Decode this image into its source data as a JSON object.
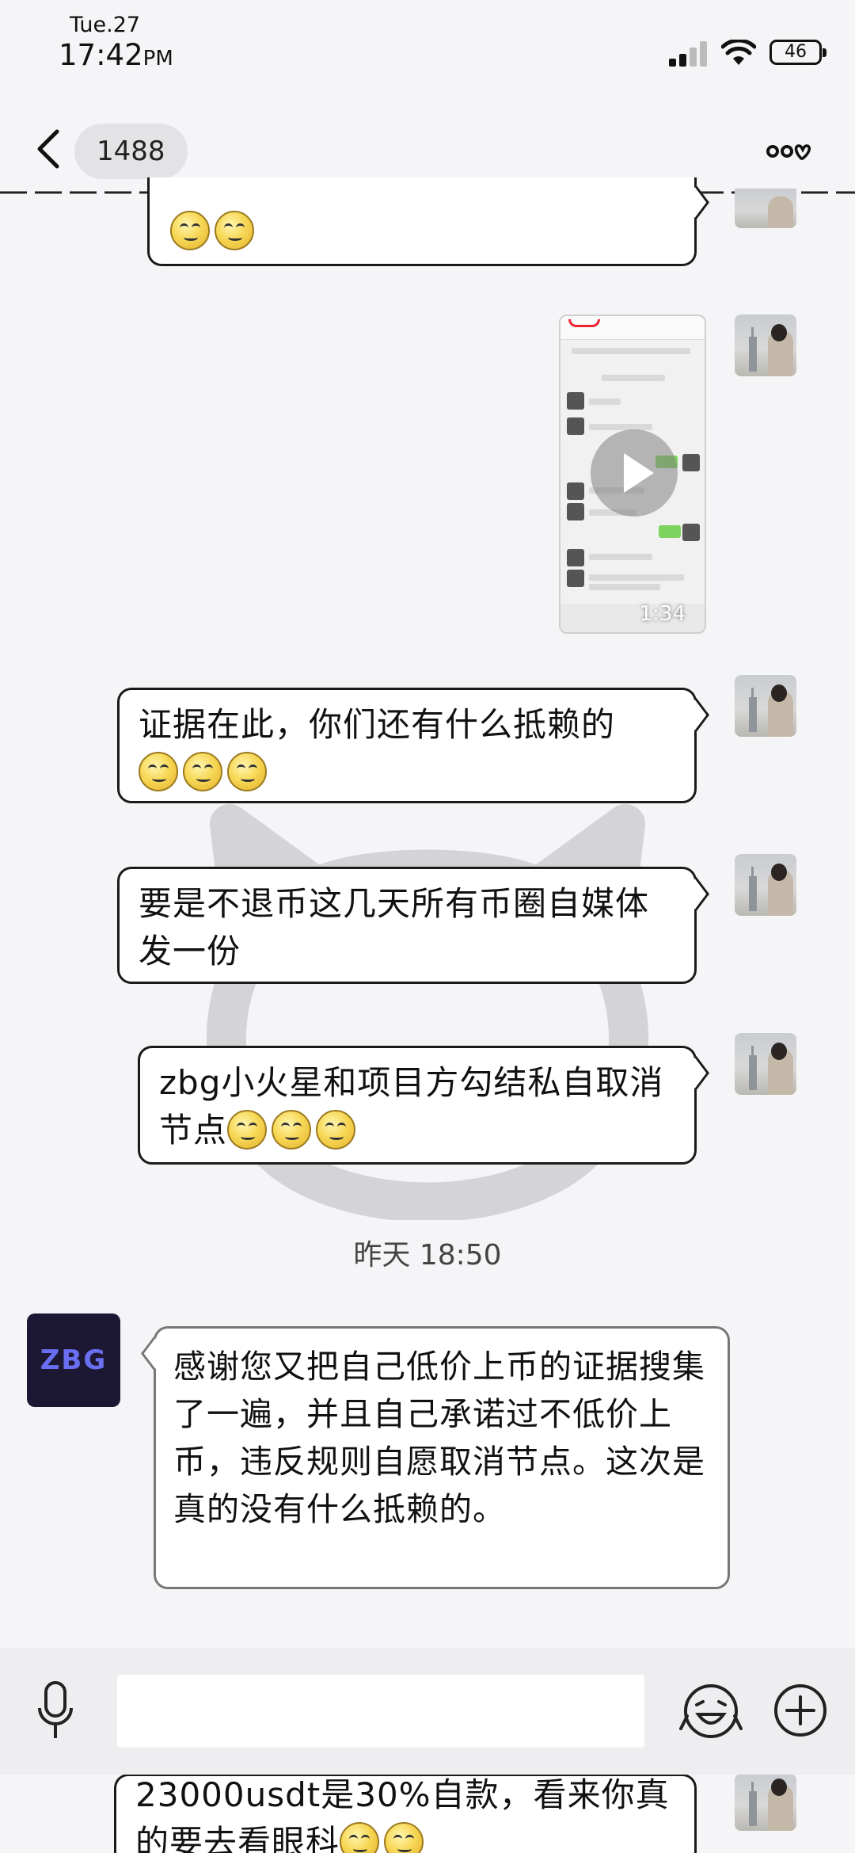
{
  "status_bar": {
    "date": "Tue.27",
    "time": "17:42",
    "ampm": "PM",
    "battery": "46"
  },
  "header": {
    "title": "1488"
  },
  "messages": [
    {
      "text": "证据在此，你们还有什么抵赖的"
    },
    {
      "text": "要是不退币这几天所有币圈自媒体发一份"
    },
    {
      "text": "zbg小火星和项目方勾结私自取消节点"
    },
    {
      "text": "感谢您又把自己低价上币的证据搜集了一遍，并且自己承诺过不低价上币，违反规则自愿取消节点。这次是真的没有什么抵赖的。"
    },
    {
      "text": "23000usdt是30%自款，看来你真的要去看眼科"
    }
  ],
  "video": {
    "duration": "1:34"
  },
  "timestamp": "昨天 18:50",
  "zbg_logo": "ZBG",
  "input": {
    "placeholder": ""
  },
  "icons": {
    "back": "chevron-left-icon",
    "more": "more-options-icon",
    "mic": "microphone-icon",
    "emoji": "emoji-icon",
    "plus": "plus-icon",
    "play": "play-icon",
    "smiley": "smiley-emoji"
  }
}
